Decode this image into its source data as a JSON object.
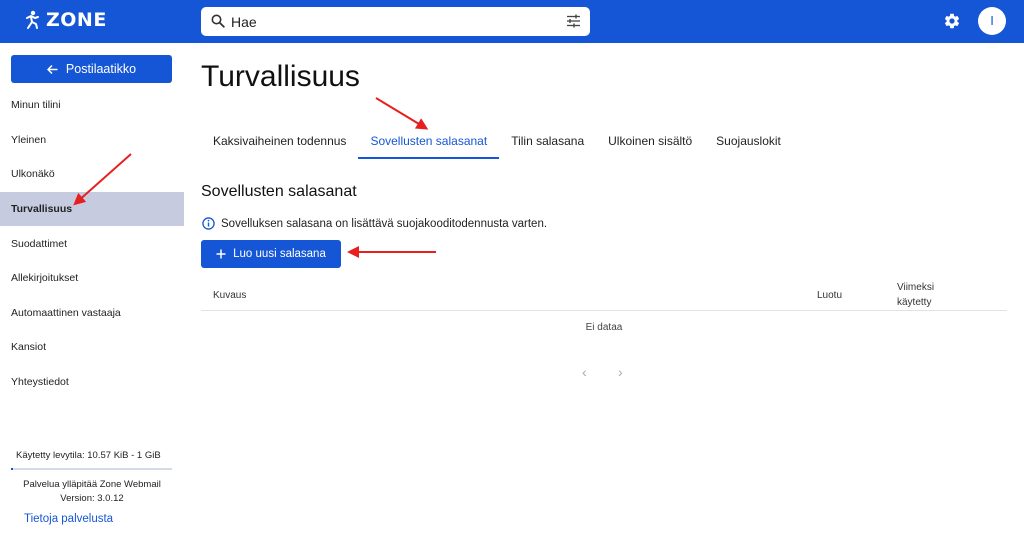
{
  "app": {
    "logo_text": "ZONE"
  },
  "search": {
    "value": "Hae"
  },
  "user": {
    "initial": "I"
  },
  "sidebar": {
    "back_label": "Postilaatikko",
    "items": [
      {
        "label": "Minun tilini"
      },
      {
        "label": "Yleinen"
      },
      {
        "label": "Ulkonäkö"
      },
      {
        "label": "Turvallisuus"
      },
      {
        "label": "Suodattimet"
      },
      {
        "label": "Allekirjoitukset"
      },
      {
        "label": "Automaattinen vastaaja"
      },
      {
        "label": "Kansiot"
      },
      {
        "label": "Yhteystiedot"
      }
    ],
    "active_index": 3,
    "usage": "Käytetty levytila: 10.57 KiB - 1 GiB",
    "usage_fraction": 0.01,
    "powered_by": "Palvelua ylläpitää Zone Webmail",
    "version": "Version: 3.0.12",
    "about_link": "Tietoja palvelusta"
  },
  "main": {
    "title": "Turvallisuus",
    "tabs": [
      {
        "label": "Kaksivaiheinen todennus"
      },
      {
        "label": "Sovellusten salasanat"
      },
      {
        "label": "Tilin salasana"
      },
      {
        "label": "Ulkoinen sisältö"
      },
      {
        "label": "Suojauslokit"
      }
    ],
    "active_tab": 1,
    "section_title": "Sovellusten salasanat",
    "info_text": "Sovelluksen salasana on lisättävä suojakooditodennusta varten.",
    "create_label": "Luo uusi salasana",
    "table": {
      "col_description": "Kuvaus",
      "col_created": "Luotu",
      "col_last_used_line1": "Viimeksi",
      "col_last_used_line2": "käytetty",
      "empty_text": "Ei dataa"
    },
    "pager": {
      "prev": "‹",
      "next": "›"
    }
  },
  "colors": {
    "brand": "#1556d6",
    "active_nav": "#c6cbe0",
    "annotation": "#e5201f"
  }
}
